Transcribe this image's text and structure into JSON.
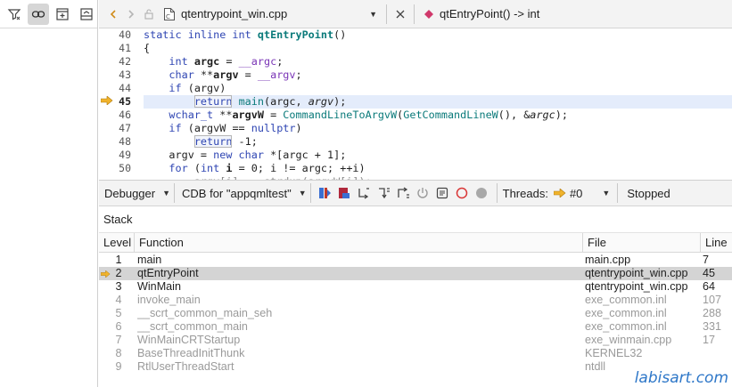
{
  "colors": {
    "accent_arrow": "#f0b32c",
    "keyword": "#2f46b3",
    "function": "#0a7a7a",
    "macro": "#7a35b6",
    "selection": "#d4d4d4",
    "dim_text": "#9a9a9a",
    "watermark": "#2e77c8"
  },
  "left_toolbar": {
    "icons": [
      "filter-icon",
      "link-icon",
      "add-split-icon",
      "collapse-icon"
    ]
  },
  "editor_toolbar": {
    "file_name": "qtentrypoint_win.cpp",
    "symbol_name": "qtEntryPoint() -> int"
  },
  "editor": {
    "current_line": "45",
    "line_numbers": [
      "40",
      "41",
      "42",
      "43",
      "44",
      "45",
      "46",
      "47",
      "48",
      "49",
      "50"
    ]
  },
  "debugger_toolbar": {
    "view_label": "Debugger",
    "engine_label": "CDB for \"appqmltest\"",
    "threads_label": "Threads:",
    "thread_value": "#0",
    "status_label": "Stopped"
  },
  "stack": {
    "title": "Stack",
    "columns": [
      "Level",
      "Function",
      "File",
      "Line"
    ],
    "rows": [
      {
        "level": "1",
        "function": "main",
        "file": "main.cpp",
        "line": "7"
      },
      {
        "level": "2",
        "function": "qtEntryPoint",
        "file": "qtentrypoint_win.cpp",
        "line": "45"
      },
      {
        "level": "3",
        "function": "WinMain",
        "file": "qtentrypoint_win.cpp",
        "line": "64"
      },
      {
        "level": "4",
        "function": "invoke_main",
        "file": "exe_common.inl",
        "line": "107"
      },
      {
        "level": "5",
        "function": "__scrt_common_main_seh",
        "file": "exe_common.inl",
        "line": "288"
      },
      {
        "level": "6",
        "function": "__scrt_common_main",
        "file": "exe_common.inl",
        "line": "331"
      },
      {
        "level": "7",
        "function": "WinMainCRTStartup",
        "file": "exe_winmain.cpp",
        "line": "17"
      },
      {
        "level": "8",
        "function": "BaseThreadInitThunk",
        "file": "KERNEL32",
        "line": ""
      },
      {
        "level": "9",
        "function": "RtlUserThreadStart",
        "file": "ntdll",
        "line": ""
      }
    ]
  },
  "watermark": "labisart.com"
}
